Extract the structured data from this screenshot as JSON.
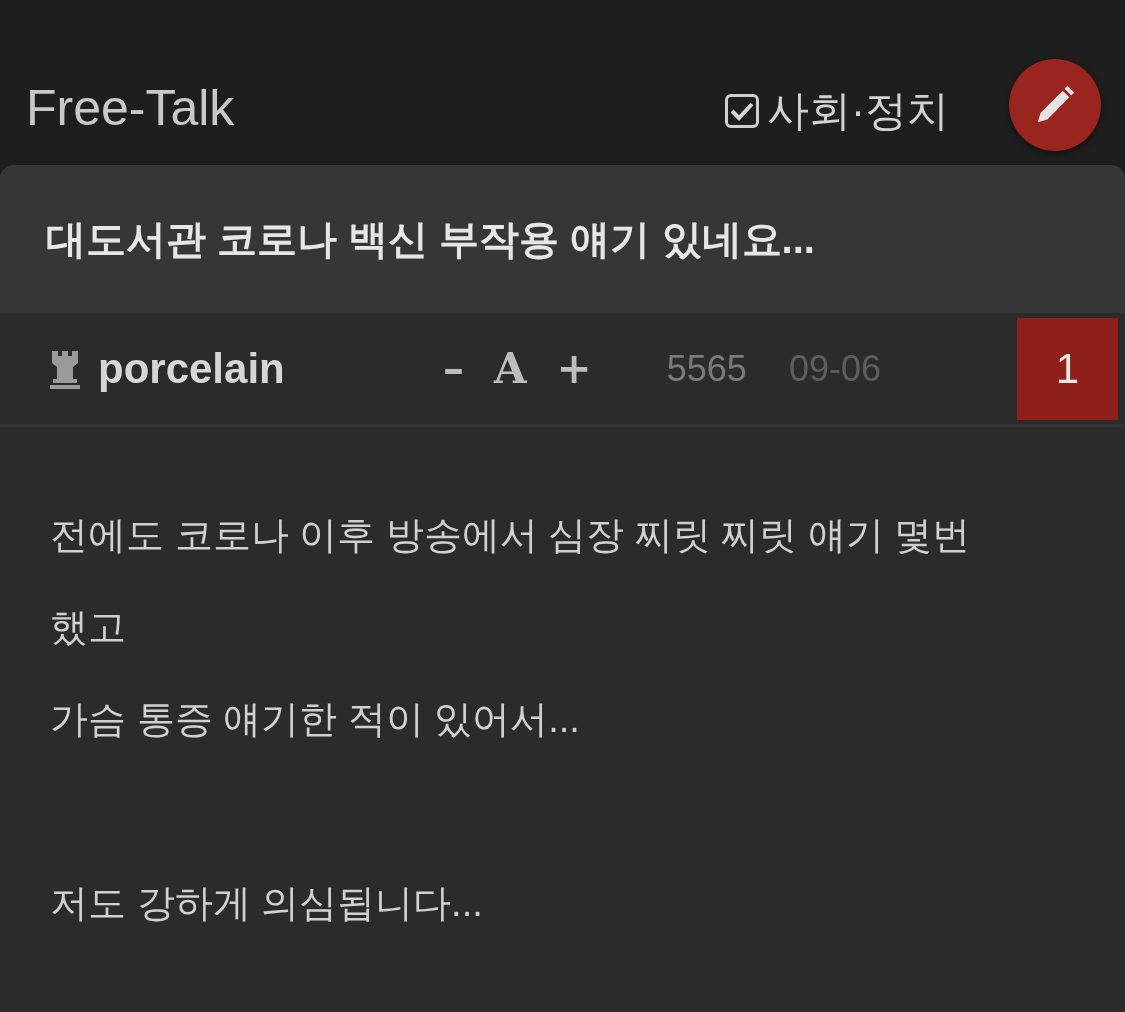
{
  "header": {
    "board_title": "Free-Talk",
    "category": {
      "label": "사회·정치",
      "checked": true
    }
  },
  "post": {
    "title": "대도서관 코로나 백신 부작용 얘기 있네요...",
    "author": "porcelain",
    "font_controls": [
      "–",
      "A",
      "+"
    ],
    "views": "5565",
    "date": "09-06",
    "comment_count": "1",
    "body": [
      {
        "lines": [
          "전에도 코로나 이후 방송에서 심장 찌릿 찌릿 얘기 몇번 했고",
          "가슴 통증 얘기한 적이 있어서..."
        ]
      },
      {
        "lines": [
          "저도 강하게 의심됩니다..."
        ]
      }
    ]
  }
}
